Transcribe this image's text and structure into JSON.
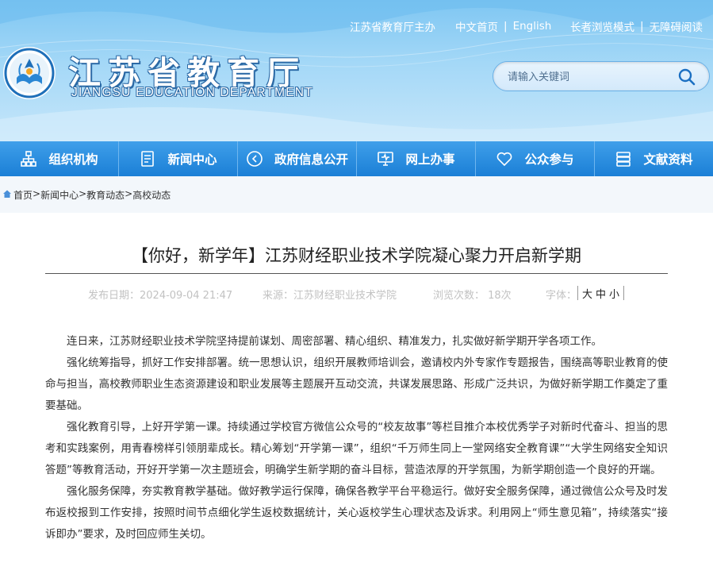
{
  "header": {
    "top_links_1": [
      "江苏省教育厅主办"
    ],
    "top_links_2": [
      "中文首页",
      "English"
    ],
    "top_links_3": [
      "长者浏览模式",
      "无障碍阅读"
    ],
    "separator": "|",
    "logo_cn": "江苏省教育厅",
    "logo_en": "JIANGSU EDUCATION DEPARTMENT",
    "search_placeholder": "请输入关键词"
  },
  "nav": {
    "items": [
      {
        "label": "组织机构",
        "icon": "org-chart-icon"
      },
      {
        "label": "新闻中心",
        "icon": "document-icon"
      },
      {
        "label": "政府信息公开",
        "icon": "circle-arrow-icon"
      },
      {
        "label": "网上办事",
        "icon": "monitor-icon"
      },
      {
        "label": "公众参与",
        "icon": "heart-icon"
      },
      {
        "label": "文献资料",
        "icon": "stack-icon"
      }
    ]
  },
  "breadcrumb": {
    "items": [
      "首页",
      "新闻中心",
      "教育动态",
      "高校动态"
    ],
    "separator": ">"
  },
  "article": {
    "title": "【你好，新学年】江苏财经职业技术学院凝心聚力开启新学期",
    "publish_date": "发布日期：2024-09-04 21:47",
    "source": "来源：江苏财经职业技术学院",
    "views": "浏览次数： 18次",
    "font_label": "字体：",
    "font_sizes": [
      "大",
      "中",
      "小"
    ],
    "paragraphs": [
      "连日来，江苏财经职业技术学院坚持提前谋划、周密部署、精心组织、精准发力，扎实做好新学期开学各项工作。",
      "强化统筹指导，抓好工作安排部署。统一思想认识，组织开展教师培训会，邀请校内外专家作专题报告，围绕高等职业教育的使命与担当，高校教师职业生态资源建设和职业发展等主题展开互动交流，共谋发展思路、形成广泛共识，为做好新学期工作奠定了重要基础。",
      "强化教育引导，上好开学第一课。持续通过学校官方微信公众号的“校友故事”等栏目推介本校优秀学子对新时代奋斗、担当的思考和实践案例，用青春榜样引领朋辈成长。精心筹划“开学第一课”，组织“千万师生同上一堂网络安全教育课”“大学生网络安全知识答题”等教育活动，开好开学第一次主题班会，明确学生新学期的奋斗目标，营造浓厚的开学氛围，为新学期创造一个良好的开端。",
      "强化服务保障，夯实教育教学基础。做好教学运行保障，确保各教学平台平稳运行。做好安全服务保障，通过微信公众号及时发布返校报到工作安排，按照时间节点细化学生返校数据统计，关心返校学生心理状态及诉求。利用网上“师生意见箱”，持续落实“接诉即办”要求，及时回应师生关切。"
    ]
  },
  "colors": {
    "header_light": "#a4d8f7",
    "nav_blue": "#1b7fd6",
    "logo_outline": "#2c6aa6",
    "meta_gray": "#c2c2c2"
  }
}
